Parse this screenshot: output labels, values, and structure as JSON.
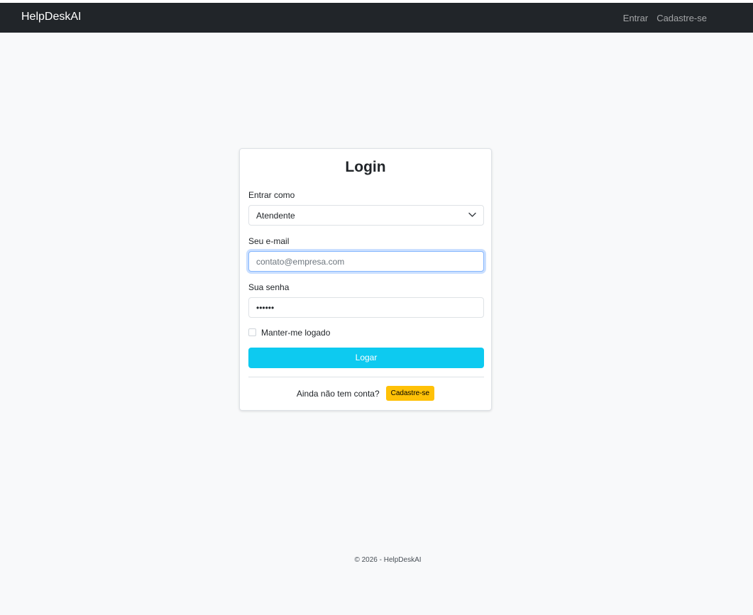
{
  "navbar": {
    "brand": "HelpDeskAI",
    "links": [
      "Entrar",
      "Cadastre-se"
    ]
  },
  "login": {
    "title": "Login",
    "role_label": "Entrar como",
    "role_value": "Atendente",
    "email_label": "Seu e-mail",
    "email_placeholder": "contato@empresa.com",
    "password_label": "Sua senha",
    "password_value": "••••••",
    "remember_label": "Manter-me logado",
    "remember_checked": false,
    "submit_label": "Logar",
    "no_account_text": "Ainda não tem conta?",
    "signup_label": "Cadastre-se"
  },
  "colors": {
    "navbar_bg": "#212529",
    "primary_button": "#0dcaf0",
    "signup_button": "#ffc107",
    "page_bg": "#f8f9fa"
  },
  "icons": {
    "select_chevron": "chevron-down-icon"
  },
  "footer": {
    "text": "© 2026 - HelpDeskAI"
  }
}
